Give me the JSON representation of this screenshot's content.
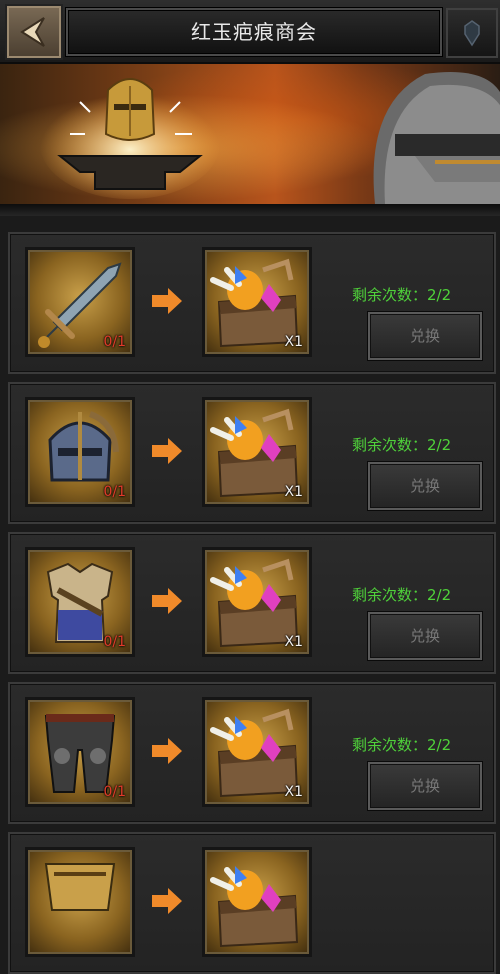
{
  "header": {
    "title": "红玉疤痕商会",
    "back_icon": "back-arrow-icon",
    "right_icon": "crest-icon"
  },
  "banner": {
    "icon_left": "anvil-helmet-icon",
    "icon_right": "knight-helmet-icon"
  },
  "rows": [
    {
      "item_icon": "sword-icon",
      "item_count": "0/1",
      "reward_icon": "treasure-chest-icon",
      "reward_count": "X1",
      "remaining_label": "剩余次数：2/2",
      "button_label": "兑换"
    },
    {
      "item_icon": "helmet-icon",
      "item_count": "0/1",
      "reward_icon": "treasure-chest-icon",
      "reward_count": "X1",
      "remaining_label": "剩余次数：2/2",
      "button_label": "兑换"
    },
    {
      "item_icon": "chest-armor-icon",
      "item_count": "0/1",
      "reward_icon": "treasure-chest-icon",
      "reward_count": "X1",
      "remaining_label": "剩余次数：2/2",
      "button_label": "兑换"
    },
    {
      "item_icon": "leg-armor-icon",
      "item_count": "0/1",
      "reward_icon": "treasure-chest-icon",
      "reward_count": "X1",
      "remaining_label": "剩余次数：2/2",
      "button_label": "兑换"
    },
    {
      "item_icon": "armor-piece-icon",
      "reward_icon": "treasure-chest-icon"
    }
  ],
  "colors": {
    "remaining_text": "#4fd13a",
    "count_red": "#e23a2a",
    "arrow_orange": "#f08a2a"
  }
}
